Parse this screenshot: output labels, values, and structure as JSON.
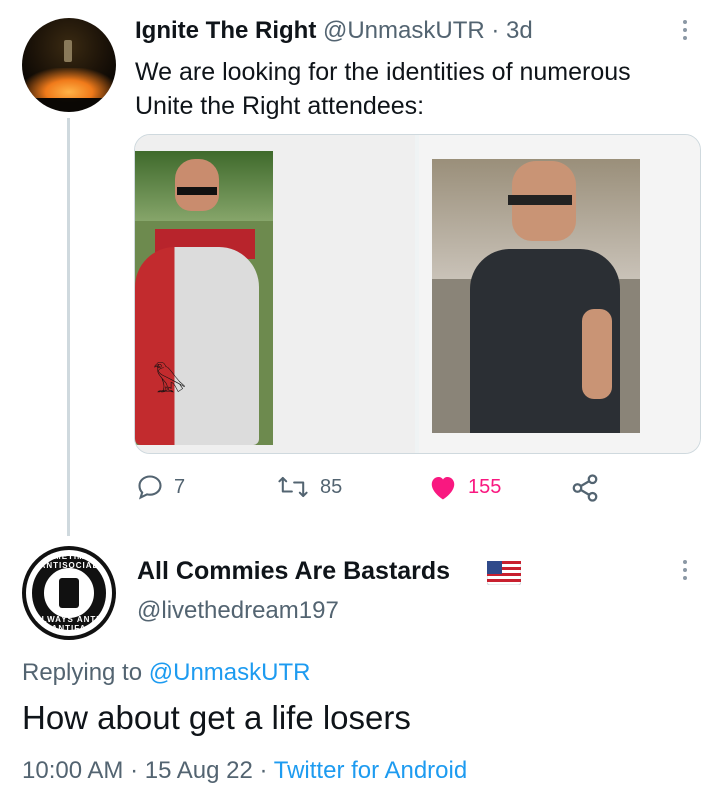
{
  "tweet1": {
    "display_name": "Ignite The Right",
    "handle": "@UnmaskUTR",
    "separator": "·",
    "age": "3d",
    "text": "We are looking for the identities of numerous Unite the Right attendees:",
    "actions": {
      "reply_icon": "reply-icon",
      "reply_count": "7",
      "retweet_icon": "retweet-icon",
      "retweet_count": "85",
      "like_icon": "heart-filled-icon",
      "like_count": "155",
      "share_icon": "share-icon"
    }
  },
  "tweet2": {
    "display_name": "All Commies Are Bastards",
    "flag_icon": "us-flag-icon",
    "handle": "@livethedream197",
    "avatar_text_top": "SOMETIMES ANTISOCIAL",
    "avatar_text_bottom": "ALWAYS ANTI-ANTIFA",
    "replying_prefix": "Replying to",
    "replying_to": "@UnmaskUTR",
    "text": "How about get a life losers",
    "time": "10:00 AM",
    "date": "15 Aug 22",
    "separator": "·",
    "source": "Twitter for Android"
  },
  "colors": {
    "text": "#0f1419",
    "muted": "#536471",
    "link": "#1d9bf0",
    "like": "#f91880",
    "thread_line": "#cfd9de"
  }
}
